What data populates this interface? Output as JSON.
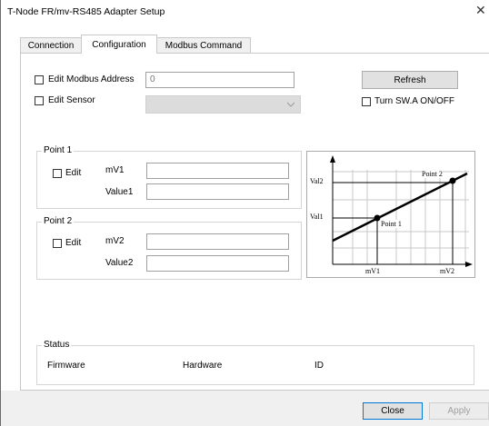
{
  "window": {
    "title": "T-Node FR/mv-RS485 Adapter Setup",
    "close_glyph": "✕"
  },
  "tabs": [
    {
      "label": "Connection",
      "active": false
    },
    {
      "label": "Configuration",
      "active": true
    },
    {
      "label": "Modbus Command",
      "active": false
    }
  ],
  "config": {
    "edit_modbus_label": "Edit Modbus Address",
    "modbus_address_value": "0",
    "edit_sensor_label": "Edit Sensor",
    "refresh_label": "Refresh",
    "turn_sw_label": "Turn SW.A ON/OFF"
  },
  "point1": {
    "title": "Point 1",
    "edit_label": "Edit",
    "mv_label": "mV1",
    "value_label": "Value1"
  },
  "point2": {
    "title": "Point 2",
    "edit_label": "Edit",
    "mv_label": "mV2",
    "value_label": "Value2"
  },
  "graph": {
    "val2_label": "Val2",
    "val1_label": "Val1",
    "point1_label": "Point 1",
    "point2_label": "Point 2",
    "mv1_label": "mV1",
    "mv2_label": "mV2"
  },
  "status": {
    "title": "Status",
    "firmware_label": "Firmware",
    "hardware_label": "Hardware",
    "id_label": "ID"
  },
  "footer": {
    "close_label": "Close",
    "apply_label": "Apply"
  }
}
